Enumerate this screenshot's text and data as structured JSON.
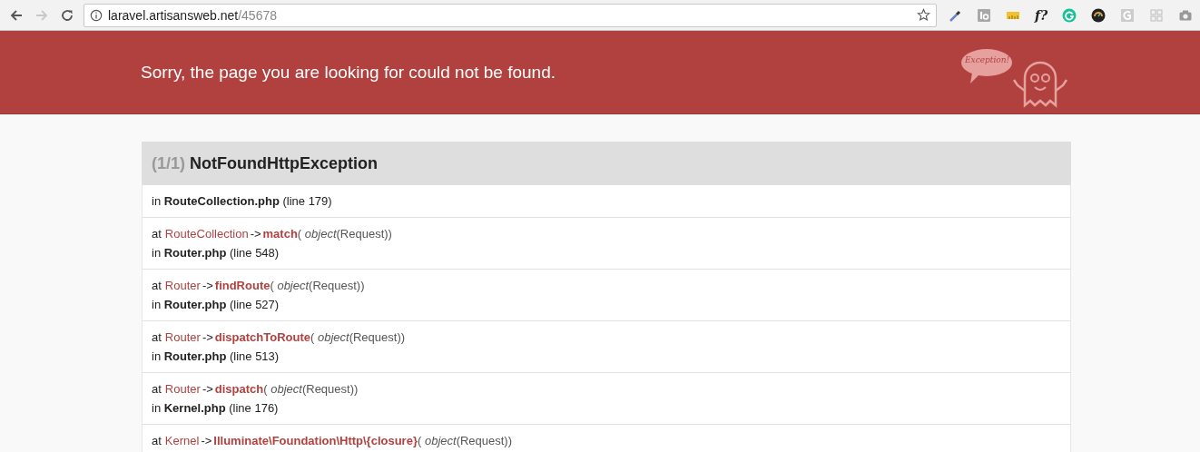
{
  "browser": {
    "url_host": "laravel.artisansweb.net",
    "url_path": "/45678",
    "back_disabled": false,
    "forward_disabled": true,
    "extension_texts": [
      "f?"
    ]
  },
  "banner": {
    "message": "Sorry, the page you are looking for could not be found.",
    "mascot_bubble": "Exception!"
  },
  "exception": {
    "count": "(1/1)",
    "name": "NotFoundHttpException",
    "trace": [
      {
        "location": "in **RouteCollection.php** (line 179)"
      },
      {
        "call": {
          "at": "at",
          "class": "RouteCollection",
          "arrow": "->",
          "function": "match",
          "args": "( *object*(Request))"
        },
        "location": "in **Router.php** (line 548)"
      },
      {
        "call": {
          "at": "at",
          "class": "Router",
          "arrow": "->",
          "function": "findRoute",
          "args": "( *object*(Request))"
        },
        "location": "in **Router.php** (line 527)"
      },
      {
        "call": {
          "at": "at",
          "class": "Router",
          "arrow": "->",
          "function": "dispatchToRoute",
          "args": "( *object*(Request))"
        },
        "location": "in **Router.php** (line 513)"
      },
      {
        "call": {
          "at": "at",
          "class": "Router",
          "arrow": "->",
          "function": "dispatch",
          "args": "( *object*(Request))"
        },
        "location": "in **Kernel.php** (line 176)"
      },
      {
        "call": {
          "at": "at",
          "class": "Kernel",
          "arrow": "->",
          "function": "Illuminate\\Foundation\\Http\\{closure}",
          "args": "( *object*(Request))"
        }
      }
    ]
  }
}
